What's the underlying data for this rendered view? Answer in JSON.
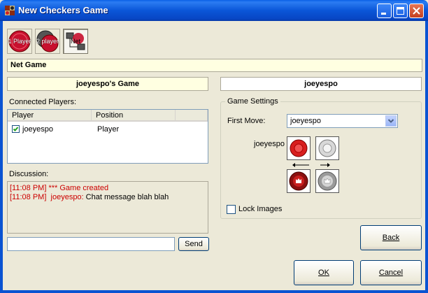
{
  "window": {
    "title": "New Checkers Game"
  },
  "mode_buttons": [
    {
      "label": "1 Player"
    },
    {
      "label": "2 player"
    },
    {
      "label": "Net"
    }
  ],
  "header": {
    "mode_title": "Net Game"
  },
  "left": {
    "game_name": "joeyespo's Game",
    "connected_players_label": "Connected Players:",
    "columns": [
      "Player",
      "Position"
    ],
    "players": [
      {
        "name": "joeyespo",
        "position": "Player",
        "checked": true
      }
    ],
    "discussion_label": "Discussion:",
    "messages": [
      {
        "time": "[11:08 PM]",
        "sender": "***",
        "text": "Game created"
      },
      {
        "time": "[11:08 PM]",
        "sender": "joeyespo:",
        "text": "Chat message blah blah"
      }
    ],
    "chat_input_value": "",
    "send_label": "Send"
  },
  "right": {
    "player_name": "joeyespo",
    "settings_label": "Game Settings",
    "first_move_label": "First Move:",
    "first_move_value": "joeyespo",
    "pieces_owner_label": "joeyespo",
    "lock_images_label": "Lock Images",
    "lock_images_checked": false
  },
  "footer": {
    "back_label": "Back",
    "ok_label": "OK",
    "cancel_label": "Cancel"
  },
  "colors": {
    "title_blue": "#0a56d8",
    "message_red": "#cc0000",
    "highlight_yellow": "#ffffe1"
  }
}
